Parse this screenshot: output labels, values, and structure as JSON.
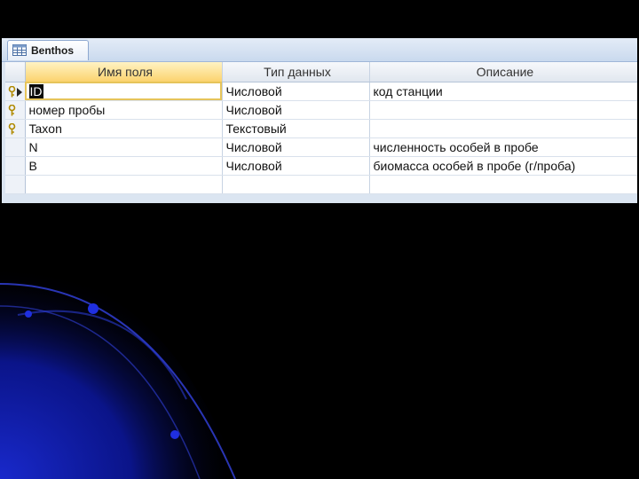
{
  "tab": {
    "label": "Benthos",
    "icon": "table-icon"
  },
  "columns": [
    "Имя поля",
    "Тип данных",
    "Описание"
  ],
  "rows": [
    {
      "name": "ID",
      "type": "Числовой",
      "description": "код станции",
      "key": true,
      "current": true
    },
    {
      "name": "номер пробы",
      "type": "Числовой",
      "description": "",
      "key": true,
      "current": false
    },
    {
      "name": "Taxon",
      "type": "Текстовый",
      "description": "",
      "key": true,
      "current": false
    },
    {
      "name": "N",
      "type": "Числовой",
      "description": "численность особей в пробе",
      "key": false,
      "current": false
    },
    {
      "name": "B",
      "type": "Числовой",
      "description": "биомасса особей в пробе (г/проба)",
      "key": false,
      "current": false
    },
    {
      "name": "",
      "type": "",
      "description": "",
      "key": false,
      "current": false
    }
  ],
  "colors": {
    "accent": "#fbd36e",
    "selection": "#0a0a0a",
    "decoration": "#1a2bd6"
  }
}
